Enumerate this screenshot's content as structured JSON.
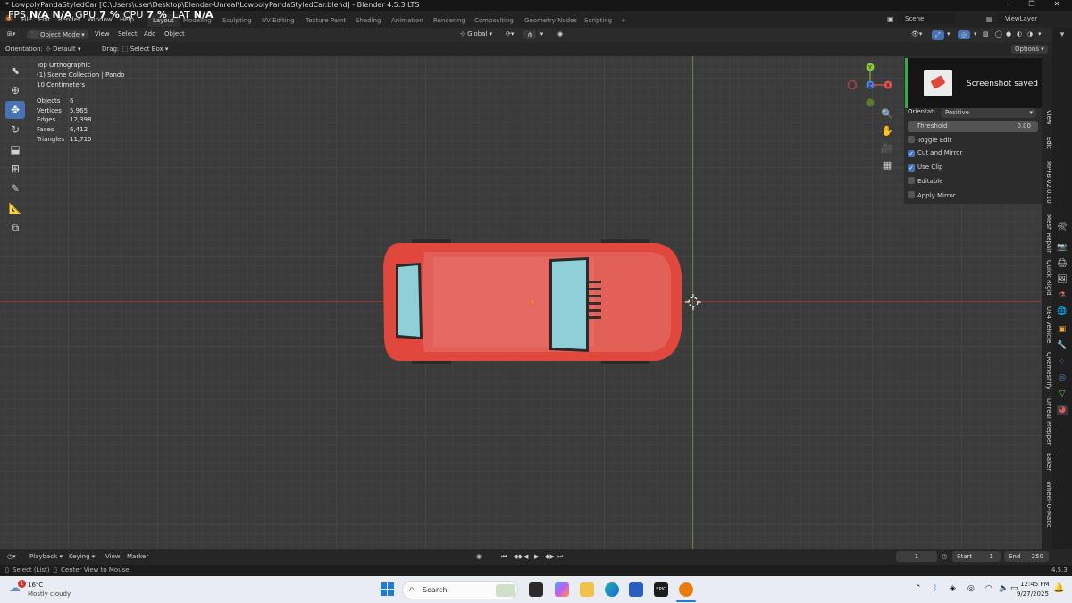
{
  "window": {
    "title": "* LowpolyPandaStyledCar [C:\\Users\\user\\Desktop\\Blender-Unreal\\LowpolyPandaStyledCar.blend] - Blender 4.5.3 LTS",
    "minimize": "–",
    "maximize": "❐",
    "close": "✕"
  },
  "hud": {
    "fps_label": "FPS",
    "fps_value": "N/A  N/A",
    "gpu_label": "GPU",
    "gpu_value": "7 %",
    "cpu_label": "CPU",
    "cpu_value": "7 %",
    "lat_label": "LAT",
    "lat_value": "N/A"
  },
  "menus": [
    "File",
    "Edit",
    "Render",
    "Window",
    "Help"
  ],
  "workspaces": [
    "Layout",
    "Modeling",
    "Sculpting",
    "UV Editing",
    "Texture Paint",
    "Shading",
    "Animation",
    "Rendering",
    "Compositing",
    "Geometry Nodes",
    "Scripting"
  ],
  "workspace_add": "+",
  "scene": {
    "label": "Scene",
    "view_layer": "ViewLayer"
  },
  "header": {
    "mode": "Object Mode",
    "menus": [
      "View",
      "Select",
      "Add",
      "Object"
    ],
    "transform": "Global"
  },
  "subheader": {
    "orientation_label": "Orientation:",
    "orientation_value": "Default",
    "drag_label": "Drag:",
    "drag_value": "Select Box",
    "options": "Options"
  },
  "viewport": {
    "view_name": "Top Orthographic",
    "collection": "(1) Scene Collection | Pando",
    "scale": "10 Centimeters",
    "stats": [
      {
        "label": "Objects",
        "value": "6"
      },
      {
        "label": "Vertices",
        "value": "5,965"
      },
      {
        "label": "Edges",
        "value": "12,398"
      },
      {
        "label": "Faces",
        "value": "6,412"
      },
      {
        "label": "Triangles",
        "value": "11,710"
      }
    ]
  },
  "gizmo": {
    "y": "Y",
    "z": "Z",
    "x": "X"
  },
  "toast": {
    "text": "Screenshot saved"
  },
  "npanel": {
    "orientation_label": "Orientati...",
    "orientation_value": "Positive",
    "threshold_label": "Threshold",
    "threshold_value": "0.00",
    "options": [
      {
        "label": "Toggle Edit",
        "checked": false
      },
      {
        "label": "Cut and Mirror",
        "checked": true
      },
      {
        "label": "Use Clip",
        "checked": true
      },
      {
        "label": "Editable",
        "checked": false
      },
      {
        "label": "Apply Mirror",
        "checked": false
      }
    ]
  },
  "vertical_tabs": [
    "View",
    "Edit",
    "MPFB v2.0.10",
    "Mesh Repair",
    "Quick Rigid",
    "UE4 Vehicle",
    "QRemeshify",
    "Unreal Prepper",
    "Baker",
    "Wheel-O-Matic"
  ],
  "timeline": {
    "menus": [
      "Playback",
      "Keying",
      "View",
      "Marker"
    ],
    "current_frame": "1",
    "start_label": "Start",
    "start_value": "1",
    "end_label": "End",
    "end_value": "250"
  },
  "statusbar": {
    "select": "Select (List)",
    "center": "Center View to Mouse",
    "version": "4.5.3"
  },
  "taskbar": {
    "weather_temp": "16°C",
    "weather_desc": "Mostly cloudy",
    "weather_badge": "1",
    "search": "Search",
    "time": "12:45 PM",
    "date": "9/27/2025"
  },
  "colors": {
    "accent": "#4772b3",
    "car_body": "#e0483e",
    "car_window": "#8ecfd8",
    "toast_border": "#38a84a"
  }
}
